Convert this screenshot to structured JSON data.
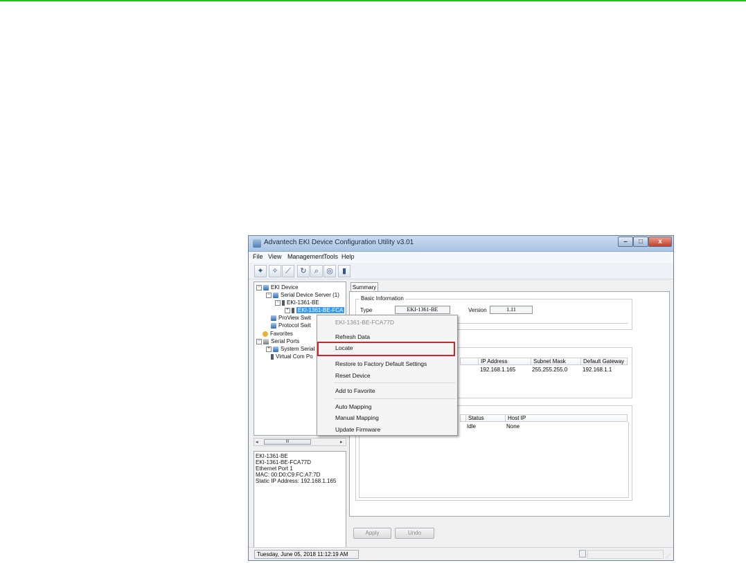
{
  "window": {
    "title": "Advantech EKI Device Configuration Utility v3.01",
    "controls": {
      "minimize": "–",
      "maximize": "□",
      "close": "x"
    }
  },
  "menubar": [
    "File",
    "View",
    "Management",
    "Tools",
    "Help"
  ],
  "toolbar_icons": [
    "device-search-icon",
    "wizard-icon",
    "clean-icon",
    "refresh-icon",
    "search-icon",
    "binoculars-icon",
    "switch-icon"
  ],
  "tree": {
    "eki_device": "EKI Device",
    "serial_device_server": "Serial Device Server (1)",
    "model": "EKI-1361-BE",
    "device": "EKI-1361-BE-FCA",
    "proview": "ProView Swit",
    "protocol": "Protocol Swit",
    "favorites": "Favorites",
    "serial_ports": "Serial Ports",
    "system_serial": "System Serial",
    "virtual_com": "Virtual Com Po"
  },
  "scrollbar": {
    "left": "◂",
    "thumb": "III",
    "right": "▸"
  },
  "info": {
    "lines": [
      "EKI-1361-BE",
      "EKI-1361-BE-FCA77D",
      "Ethernet Port 1",
      "MAC: 00:D0:C9:FC:A7:7D",
      "Static IP Address: 192.168.1.165"
    ]
  },
  "tabs": {
    "summary": "Summary"
  },
  "basic": {
    "legend": "Basic Information",
    "type_label": "Type",
    "type_value": "EKI-1361-BE",
    "version_label": "Version",
    "version_value": "1.11"
  },
  "network": {
    "headers": [
      "IP Address",
      "Subnet Mask",
      "Default Gateway"
    ],
    "row": [
      "192.168.1.165",
      "255.255.255.0",
      "192.168.1.1"
    ]
  },
  "ports": {
    "headers": [
      "Status",
      "Host IP"
    ],
    "row": [
      "Idle",
      "None"
    ]
  },
  "buttons": {
    "apply": "Apply",
    "undo": "Undo"
  },
  "status": {
    "datetime": "Tuesday, June 05, 2018 11:12:19 AM"
  },
  "context_menu": {
    "header": "EKI-1361-BE-FCA77D",
    "refresh": "Refresh Data",
    "locate": "Locate",
    "restore": "Restore to Factory Default Settings",
    "reset": "Reset Device",
    "add_favorite": "Add to Favorite",
    "auto_mapping": "Auto Mapping",
    "manual_mapping": "Manual Mapping",
    "update_firmware": "Update Firmware"
  },
  "colors": {
    "highlight_box": "#d9202d",
    "top_line": "#21c21f",
    "selection": "#3399ff"
  }
}
